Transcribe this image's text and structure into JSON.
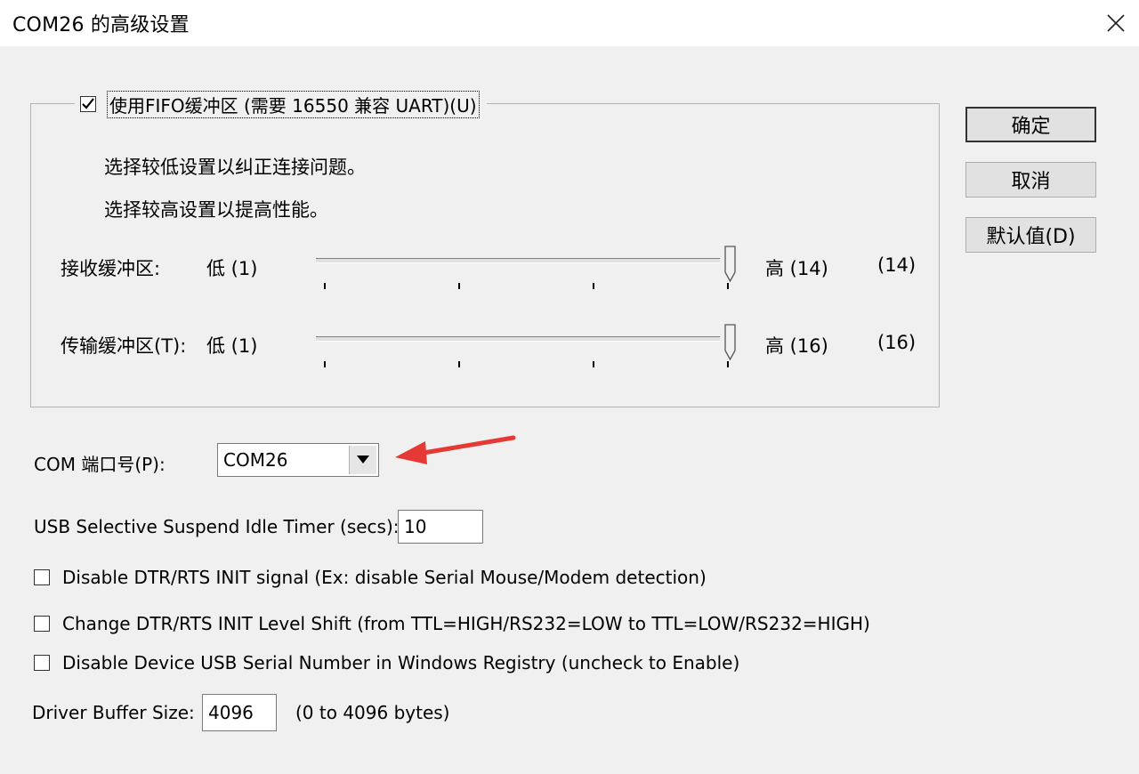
{
  "window": {
    "title": "COM26 的高级设置",
    "close_icon": "close-icon"
  },
  "fifo": {
    "checked": true,
    "label": "使用FIFO缓冲区 (需要 16550 兼容 UART)(U)",
    "hint_low": "选择较低设置以纠正连接问题。",
    "hint_high": "选择较高设置以提高性能。"
  },
  "receive_buffer": {
    "label": "接收缓冲区:",
    "low_label": "低 (1)",
    "high_label": "高 (14)",
    "value_display": "(14)",
    "min": 1,
    "max": 14,
    "value": 14
  },
  "transmit_buffer": {
    "label": "传输缓冲区(T):",
    "low_label": "低 (1)",
    "high_label": "高 (16)",
    "value_display": "(16)",
    "min": 1,
    "max": 16,
    "value": 16
  },
  "buttons": {
    "ok": "确定",
    "cancel": "取消",
    "defaults": "默认值(D)"
  },
  "com_port": {
    "label": "COM 端口号(P):",
    "value": "COM26",
    "annotation_color": "#e53935"
  },
  "usb_suspend": {
    "label": "USB Selective Suspend Idle Timer (secs):",
    "value": "10"
  },
  "options": [
    {
      "label": "Disable DTR/RTS INIT signal (Ex: disable Serial Mouse/Modem detection)",
      "checked": false
    },
    {
      "label": "Change DTR/RTS INIT Level Shift (from TTL=HIGH/RS232=LOW to TTL=LOW/RS232=HIGH)",
      "checked": false
    },
    {
      "label": "Disable Device USB Serial Number in Windows Registry (uncheck to Enable)",
      "checked": false
    }
  ],
  "driver_buffer": {
    "label": "Driver Buffer Size:",
    "value": "4096",
    "range_note": "(0 to 4096 bytes)"
  }
}
